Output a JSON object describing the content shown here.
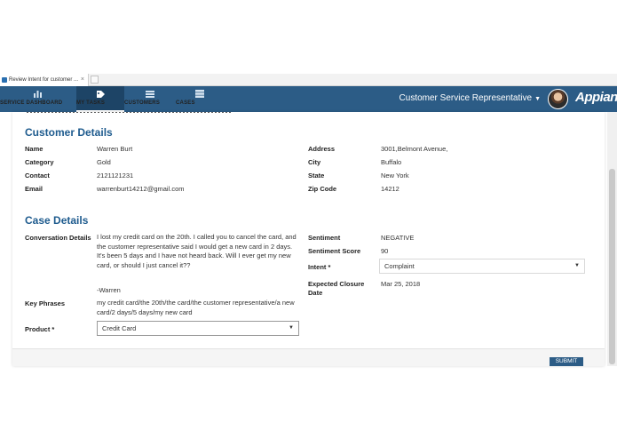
{
  "browser": {
    "tab_title": "Review Intent for customer ...",
    "tab_close": "×"
  },
  "nav": {
    "items": [
      {
        "label": "SERVICE DASHBOARD",
        "icon": "bar-chart-icon"
      },
      {
        "label": "MY TASKS",
        "icon": "tag-icon",
        "active": true
      },
      {
        "label": "CUSTOMERS",
        "icon": "list-icon"
      },
      {
        "label": "CASES",
        "icon": "stack-icon"
      }
    ],
    "role_label": "Customer Service Representative",
    "role_caret": "▼",
    "brand": "Appian"
  },
  "customer_details": {
    "title": "Customer Details",
    "name_label": "Name",
    "name_value": "Warren Burt",
    "category_label": "Category",
    "category_value": "Gold",
    "contact_label": "Contact",
    "contact_value": "2121121231",
    "email_label": "Email",
    "email_value": "warrenburt14212@gmail.com",
    "address_label": "Address",
    "address_value": "3001,Belmont Avenue,",
    "city_label": "City",
    "city_value": "Buffalo",
    "state_label": "State",
    "state_value": "New York",
    "zip_label": "Zip Code",
    "zip_value": "14212"
  },
  "case_details": {
    "title": "Case Details",
    "conversation_label": "Conversation Details",
    "conversation_text": "I lost my credit card on the 20th. I called you to cancel the card, and the customer representative said I would get a new card in 2 days. It's been 5 days and I have not heard back. Will I ever get my new card, or should I just cancel it??",
    "conversation_sign": "-Warren",
    "key_phrases_label": "Key Phrases",
    "key_phrases_value": "my credit card/the 20th/the card/the customer representative/a new card/2 days/5 days/my new card",
    "product_label": "Product *",
    "product_value": "Credit Card",
    "sentiment_label": "Sentiment",
    "sentiment_value": "NEGATIVE",
    "sentiment_score_label": "Sentiment Score",
    "sentiment_score_value": "90",
    "intent_label": "Intent *",
    "intent_value": "Complaint",
    "closure_label": "Expected Closure Date",
    "closure_value": "Mar 25, 2018"
  },
  "footer": {
    "submit_label": "SUBMIT"
  },
  "colors": {
    "header_bg": "#2c5c86",
    "section_title": "#1e5b8e"
  }
}
